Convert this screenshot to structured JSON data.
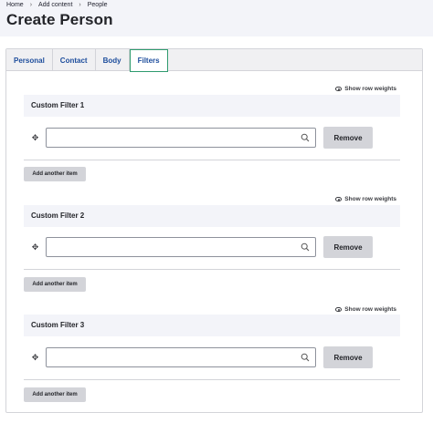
{
  "breadcrumb": {
    "items": [
      "Home",
      "Add content",
      "People"
    ],
    "separator": "›"
  },
  "page": {
    "title": "Create Person"
  },
  "tabs": [
    {
      "label": "Personal",
      "active": false
    },
    {
      "label": "Contact",
      "active": false
    },
    {
      "label": "Body",
      "active": false
    },
    {
      "label": "Filters",
      "active": true
    }
  ],
  "filters": [
    {
      "weights_label": "Show row weights",
      "title": "Custom Filter 1",
      "value": "",
      "remove_label": "Remove",
      "add_label": "Add another item"
    },
    {
      "weights_label": "Show row weights",
      "title": "Custom Filter 2",
      "value": "",
      "remove_label": "Remove",
      "add_label": "Add another item"
    },
    {
      "weights_label": "Show row weights",
      "title": "Custom Filter 3",
      "value": "",
      "remove_label": "Remove",
      "add_label": "Add another item"
    }
  ],
  "icons": {
    "drag": "drag-handle-icon",
    "search": "search-icon",
    "eye": "eye-icon"
  },
  "colors": {
    "active_tab_border": "#2e9b6e",
    "link": "#1d4d9c",
    "button_bg": "#d3d4d9"
  }
}
